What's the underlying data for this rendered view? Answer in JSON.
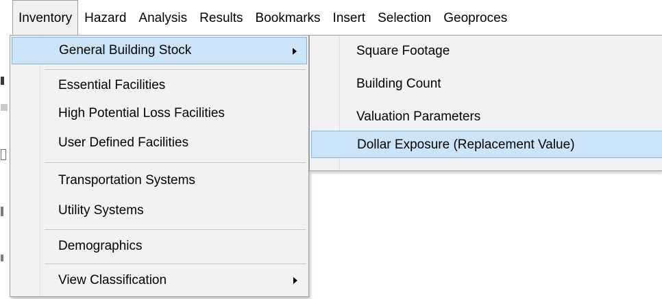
{
  "menubar": {
    "items": [
      {
        "label": "Inventory"
      },
      {
        "label": "Hazard"
      },
      {
        "label": "Analysis"
      },
      {
        "label": "Results"
      },
      {
        "label": "Bookmarks"
      },
      {
        "label": "Insert"
      },
      {
        "label": "Selection"
      },
      {
        "label": "Geoproces"
      }
    ]
  },
  "inventory_menu": {
    "items": [
      {
        "label": "General Building Stock",
        "has_submenu": true,
        "highlighted": true
      },
      {
        "label": "Essential Facilities"
      },
      {
        "label": "High Potential Loss Facilities"
      },
      {
        "label": "User Defined Facilities"
      },
      {
        "label": "Transportation Systems"
      },
      {
        "label": "Utility Systems"
      },
      {
        "label": "Demographics"
      },
      {
        "label": "View Classification",
        "has_submenu": true
      }
    ]
  },
  "general_building_stock_submenu": {
    "items": [
      {
        "label": "Square Footage"
      },
      {
        "label": "Building Count"
      },
      {
        "label": "Valuation Parameters"
      },
      {
        "label": "Dollar Exposure (Replacement Value)",
        "highlighted": true
      }
    ]
  },
  "icons": {
    "submenu_arrow": "chevron-right-icon"
  },
  "colors": {
    "highlight_fill": "#cce4f7",
    "highlight_border": "#7eb4ea",
    "menu_bg": "#f2f2f2"
  }
}
